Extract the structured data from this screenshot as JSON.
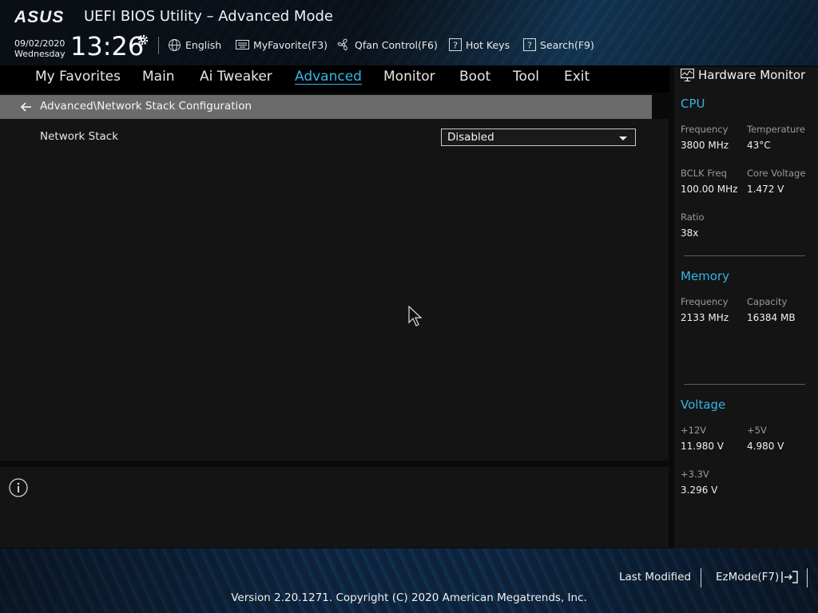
{
  "header": {
    "brand": "ASUS",
    "title": "UEFI BIOS Utility – Advanced Mode",
    "date": "09/02/2020",
    "day": "Wednesday",
    "time": "13:26",
    "toolbar": {
      "language": "English",
      "myfavorite": "MyFavorite(F3)",
      "qfan": "Qfan Control(F6)",
      "hotkeys": "Hot Keys",
      "search": "Search(F9)"
    }
  },
  "nav": {
    "items": [
      "My Favorites",
      "Main",
      "Ai Tweaker",
      "Advanced",
      "Monitor",
      "Boot",
      "Tool",
      "Exit"
    ],
    "active": "Advanced"
  },
  "breadcrumb": "Advanced\\Network Stack Configuration",
  "settings": {
    "network_stack_label": "Network Stack",
    "network_stack_value": "Disabled"
  },
  "hardware_monitor": {
    "title": "Hardware Monitor",
    "cpu": {
      "title": "CPU",
      "frequency_label": "Frequency",
      "frequency": "3800 MHz",
      "temperature_label": "Temperature",
      "temperature": "43°C",
      "bclk_label": "BCLK Freq",
      "bclk": "100.00 MHz",
      "core_voltage_label": "Core Voltage",
      "core_voltage": "1.472 V",
      "ratio_label": "Ratio",
      "ratio": "38x"
    },
    "memory": {
      "title": "Memory",
      "frequency_label": "Frequency",
      "frequency": "2133 MHz",
      "capacity_label": "Capacity",
      "capacity": "16384 MB"
    },
    "voltage": {
      "title": "Voltage",
      "v12_label": "+12V",
      "v12": "11.980 V",
      "v5_label": "+5V",
      "v5": "4.980 V",
      "v33_label": "+3.3V",
      "v33": "3.296 V"
    }
  },
  "footer": {
    "last_modified": "Last Modified",
    "ezmode": "EzMode(F7)",
    "version": "Version 2.20.1271. Copyright (C) 2020 American Megatrends, Inc."
  },
  "colors": {
    "accent": "#37b6e6",
    "panel": "#141414",
    "breadcrumb_bg": "#6b6b6b"
  }
}
